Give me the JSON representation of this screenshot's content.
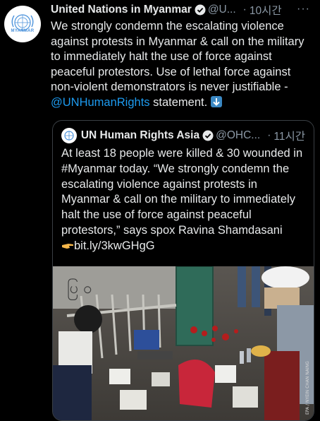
{
  "tweet": {
    "display_name": "United Nations in Myanmar",
    "handle": "@U...",
    "time": "10시간",
    "more_icon": "···",
    "text_main": "We strongly condemn the escalating violence against protests in Myanmar & call on the military to immediately halt the use of force against peaceful protestors. Use of lethal force against non-violent demonstrators is never justifiable -",
    "mention": "@UNHumanRights",
    "text_end": " statement.",
    "avatar_caption": "MYANMAR"
  },
  "quote": {
    "display_name": "UN Human Rights Asia",
    "handle": "@OHC...",
    "time": "11시간",
    "text_1": "At least 18 people were killed & 30 wounded in #Myanmar today. “We strongly condemn the escalating violence against protests in Myanmar & call on the military to immediately halt the use of force against peaceful protestors,” says spox Ravina Shamdasani",
    "link": "bit.ly/3kwGHgG",
    "photo_credit": "EPA / NYEIN CHAN NAING",
    "wall_text": "ပြ ဝ"
  },
  "colors": {
    "background": "#000000",
    "text": "#e7e9ea",
    "muted": "#8b98a5",
    "link": "#1d9bf0",
    "verified": "#1d9bf0",
    "un_blue": "#4b92db"
  },
  "icons": [
    "un-emblem-icon",
    "verified-badge-icon",
    "more-icon",
    "down-arrow-emoji-icon",
    "pointing-hand-emoji-icon"
  ]
}
